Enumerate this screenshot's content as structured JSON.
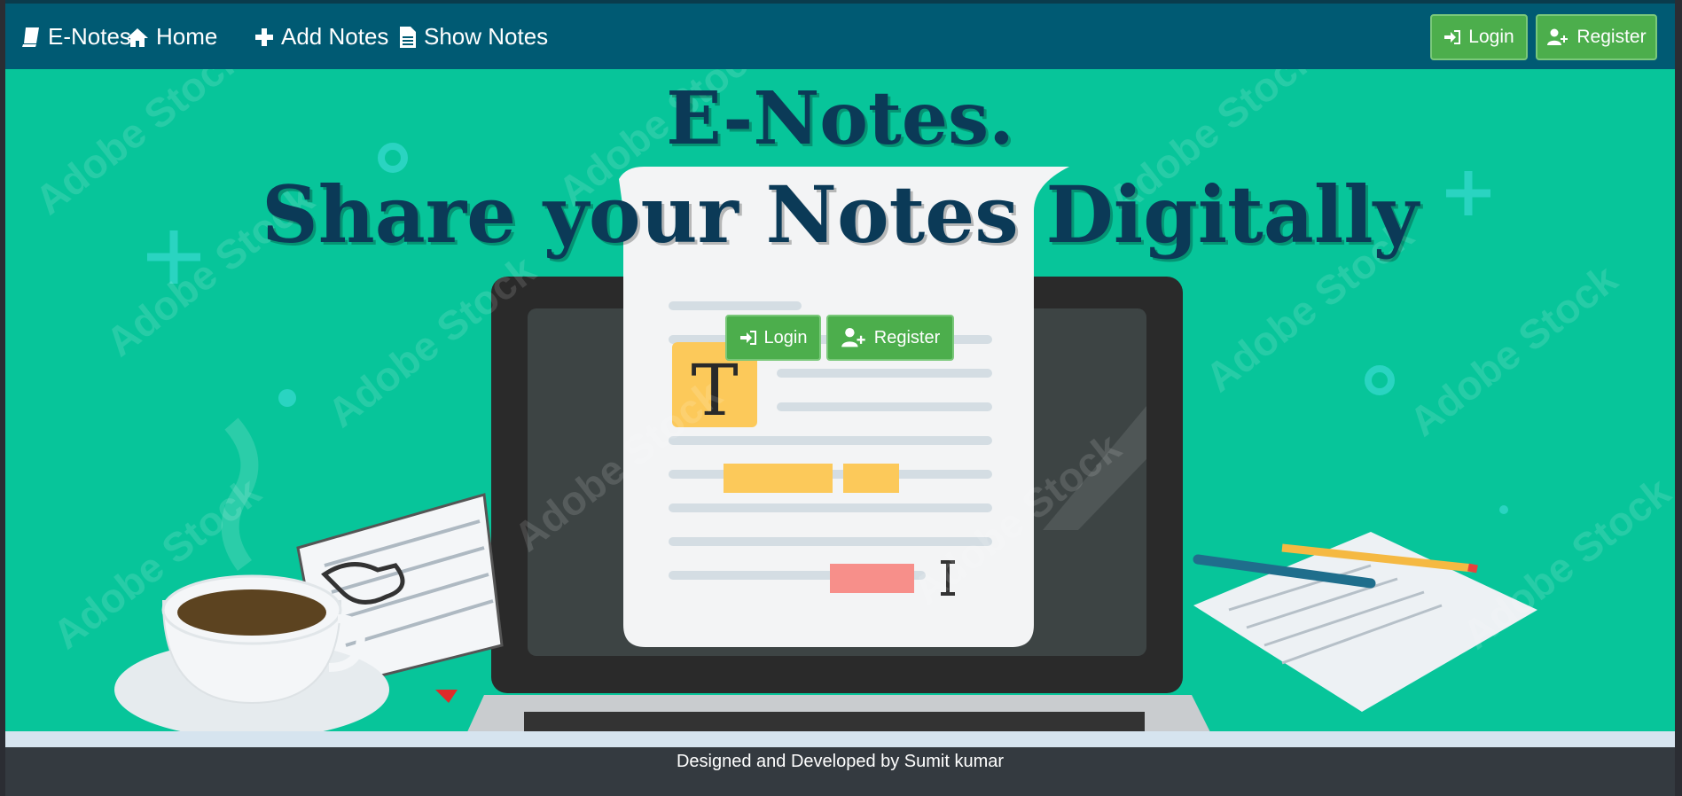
{
  "navbar": {
    "brand": "E-Notes",
    "items": [
      {
        "label": "Home",
        "icon": "home-icon"
      },
      {
        "label": "Add Notes",
        "icon": "plus-icon"
      },
      {
        "label": "Show Notes",
        "icon": "file-icon"
      }
    ],
    "login_label": "Login",
    "register_label": "Register"
  },
  "hero": {
    "title_line1": "E-Notes.",
    "title_line2": "Share your Notes Digitally",
    "login_label": "Login",
    "register_label": "Register",
    "watermark": "Adobe Stock",
    "illustration_letter": "T"
  },
  "footer": {
    "text": "Designed and Developed by Sumit kumar"
  },
  "colors": {
    "navbar": "#005a73",
    "hero_bg": "#07c59a",
    "button_green": "#4cae4c",
    "title_color": "#0b3a57",
    "footer_bg": "#343a40"
  }
}
